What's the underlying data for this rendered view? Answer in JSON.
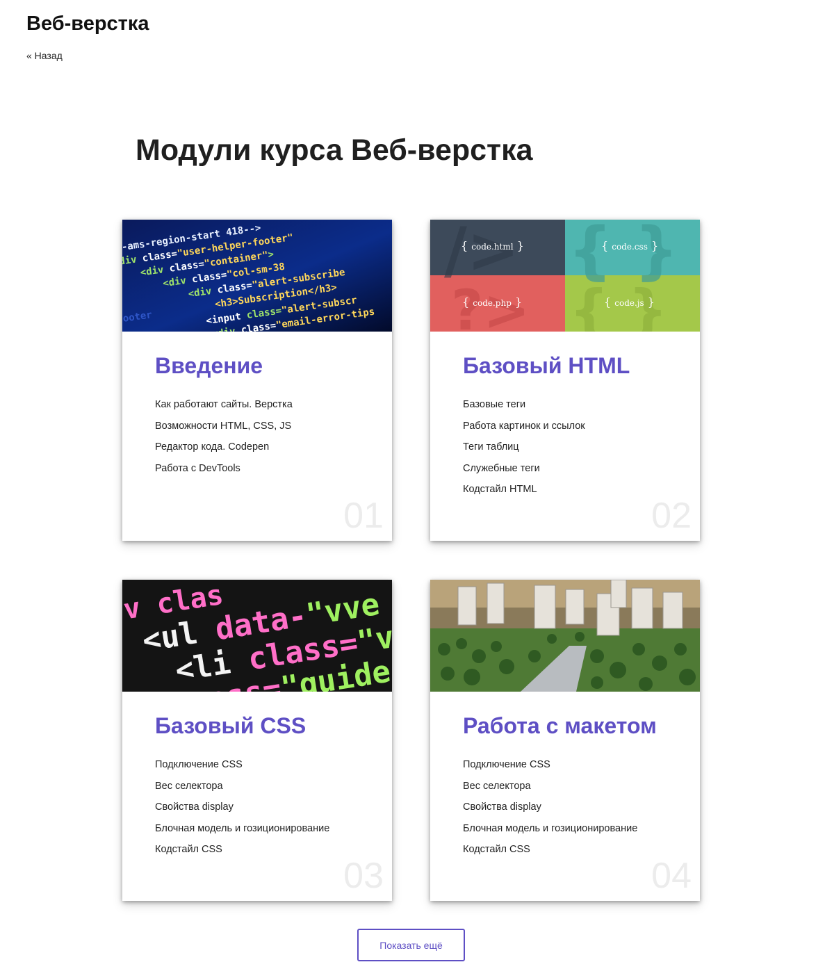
{
  "header": {
    "site_title": "Веб-верстка",
    "back_link": "« Назад"
  },
  "main": {
    "heading": "Модули курса Веб-верстка",
    "more_button": "Показать ещё"
  },
  "cards": [
    {
      "title": "Введение",
      "number": "01",
      "items": [
        "Как работают сайты. Верстка",
        "Возможности HTML, CSS, JS",
        "Редактор кода. Codepen",
        "Работа с DevTools"
      ]
    },
    {
      "title": "Базовый HTML",
      "number": "02",
      "items": [
        "Базовые теги",
        "Работа картинок и ссылок",
        "Теги таблиц",
        "Служебные теги",
        "Кодстайл HTML"
      ],
      "image_tiles": [
        "code.html",
        "code.css",
        "code.php",
        "code.js"
      ]
    },
    {
      "title": "Базовый CSS",
      "number": "03",
      "items": [
        "Подключение CSS",
        "Вес селектора",
        "Свойства display",
        "Блочная модель и гозиционирование",
        "Кодстайл CSS"
      ]
    },
    {
      "title": "Работа с макетом",
      "number": "04",
      "items": [
        "Подключение CSS",
        "Вес селектора",
        "Свойства display",
        "Блочная модель и гозиционирование",
        "Кодстайл CSS"
      ]
    }
  ],
  "colors": {
    "accent": "#5e4fc4",
    "tile_dark": "#3d4a5a",
    "tile_teal": "#4fb6b0",
    "tile_red": "#e1605e",
    "tile_green": "#a4c84a"
  }
}
